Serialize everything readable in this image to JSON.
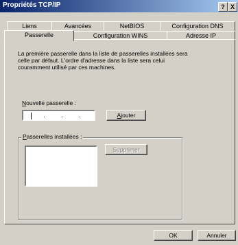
{
  "window": {
    "title": "Propriétés TCP/IP",
    "help_label": "?",
    "close_label": "X"
  },
  "tabs": {
    "row1": [
      "Liens",
      "Avancées",
      "NetBIOS",
      "Configuration DNS"
    ],
    "row2": [
      "Passerelle",
      "Configuration WINS",
      "Adresse IP"
    ],
    "active": "Passerelle"
  },
  "description": "La première passerelle dans la liste de passerelles installées sera celle par défaut. L'ordre d'adresse dans la liste sera celui couramment utilisé par ces machines.",
  "new_gateway": {
    "label_first": "N",
    "label_rest": "ouvelle passerelle :",
    "ip_value": "",
    "add_first": "A",
    "add_rest": "jouter"
  },
  "installed": {
    "label_first": "P",
    "label_rest": "asserelles installées :",
    "remove_label": "Supprimer",
    "items": []
  },
  "footer": {
    "ok_label": "OK",
    "cancel_label": "Annuler"
  }
}
